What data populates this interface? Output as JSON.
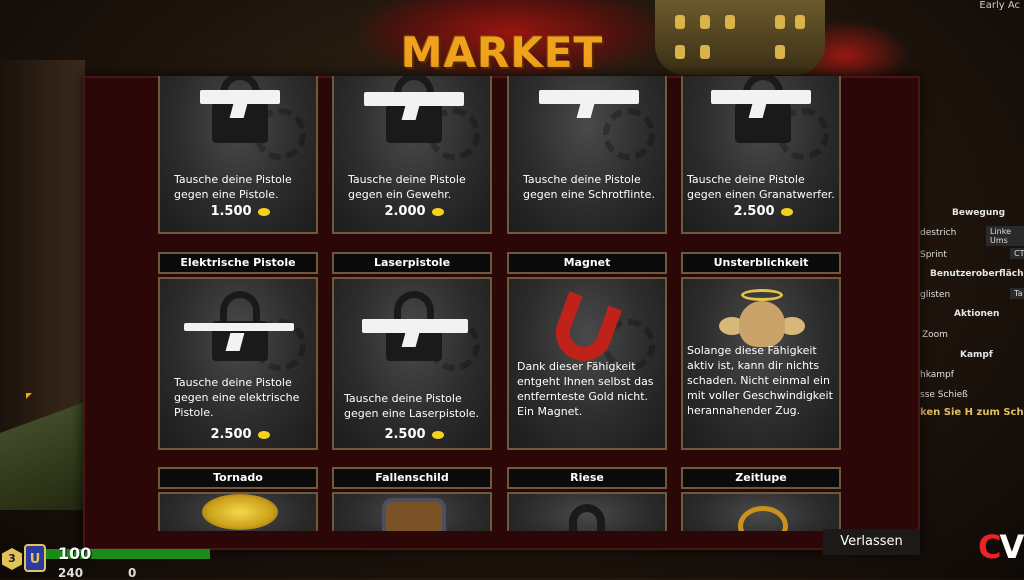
{
  "header": {
    "title": "MARKET",
    "badge": "Early Ac"
  },
  "settings": {
    "sections": [
      {
        "heading": "Bewegung"
      },
      {
        "heading": "Benutzeroberfläche"
      },
      {
        "heading": "Aktionen"
      },
      {
        "heading": "Kampf"
      }
    ],
    "rows": [
      "destrich",
      "Sprint",
      "glisten",
      "Zoom",
      "hkampf",
      "sse Schieß"
    ],
    "values": [
      "Linke Ums",
      "CT",
      "Ta",
      "",
      "",
      ""
    ],
    "hint": "ken Sie H zum Schli"
  },
  "shop": {
    "items": [
      {
        "name": "",
        "description": "Tausche deine Pistole gegen eine Pistole.",
        "price": "1.500",
        "locked": true
      },
      {
        "name": "",
        "description": "Tausche deine Pistole gegen ein Gewehr.",
        "price": "2.000",
        "locked": true
      },
      {
        "name": "",
        "description": "Tausche deine Pistole gegen eine Schrotflinte.",
        "price": "",
        "locked": false
      },
      {
        "name": "",
        "description": "Tausche deine Pistole gegen einen Granatwerfer.",
        "price": "2.500",
        "locked": true
      },
      {
        "name": "Elektrische Pistole",
        "description": "Tausche deine Pistole gegen eine elektrische Pistole.",
        "price": "2.500",
        "locked": true
      },
      {
        "name": "Laserpistole",
        "description": "Tausche deine Pistole gegen eine Laserpistole.",
        "price": "2.500",
        "locked": true
      },
      {
        "name": "Magnet",
        "description": "Dank dieser Fähigkeit entgeht Ihnen selbst das entfernteste Gold nicht. Ein Magnet.",
        "price": "",
        "locked": false
      },
      {
        "name": "Unsterblichkeit",
        "description": "Solange diese Fähigkeit aktiv ist, kann dir nichts schaden. Nicht einmal ein mit voller Geschwindigkeit herannahender Zug.",
        "price": "",
        "locked": false
      },
      {
        "name": "Tornado",
        "description": "",
        "price": "",
        "locked": false
      },
      {
        "name": "Fallenschild",
        "description": "",
        "price": "",
        "locked": false
      },
      {
        "name": "Riese",
        "description": "",
        "price": "",
        "locked": false
      },
      {
        "name": "Zeitlupe",
        "description": "",
        "price": "",
        "locked": false
      }
    ],
    "exit_label": "Verlassen"
  },
  "hud": {
    "health": "100",
    "level": "3",
    "class_letter": "U",
    "ammo": "240",
    "ammo2": "0"
  },
  "colors": {
    "panel_bg": "#2b0708",
    "title": "#f0a21c",
    "coin": "#f2d21a",
    "frame": "#6b5a3c"
  },
  "logo": {
    "text_c": "C",
    "text_v": "V"
  }
}
